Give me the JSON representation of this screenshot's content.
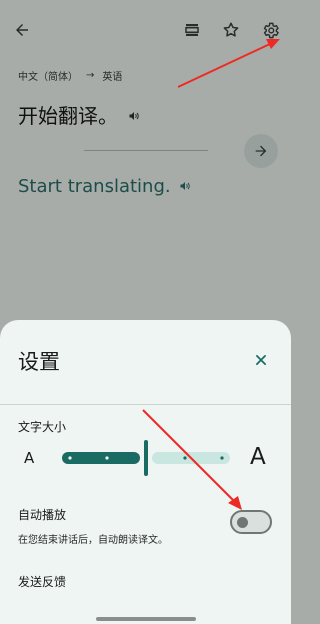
{
  "header": {
    "back_icon": "arrow-left-icon",
    "saved_icon": "bookmark-list-icon",
    "star_icon": "star-icon",
    "settings_icon": "gear-icon"
  },
  "languages": {
    "source": "中文（简体）",
    "arrow": "→",
    "target": "英语"
  },
  "source_text": "开始翻译。",
  "translated_text": "Start translating.",
  "settings": {
    "title": "设置",
    "font_size": {
      "label": "文字大小",
      "small_a": "A",
      "large_a": "A",
      "level_fraction": 0.5
    },
    "autoplay": {
      "label": "自动播放",
      "description": "在您结束讲话后，自动朗读译文。",
      "enabled": false
    },
    "feedback_label": "发送反馈"
  },
  "colors": {
    "accent": "#1a6b63",
    "annotation": "#ee2a24"
  }
}
